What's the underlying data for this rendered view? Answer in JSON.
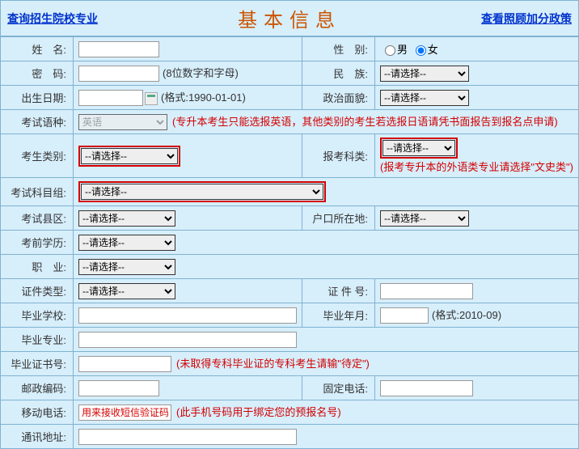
{
  "header": {
    "link_left": "查询招生院校专业",
    "title": "基本信息",
    "link_right": "查看照顾加分政策"
  },
  "labels": {
    "name": "姓　名:",
    "gender": "性　别:",
    "password": "密　码:",
    "ethnic": "民　族:",
    "birthday": "出生日期:",
    "political": "政治面貌:",
    "exam_lang": "考试语种:",
    "cand_type": "考生类别:",
    "exam_cat": "报考科类:",
    "subject_grp": "考试科目组:",
    "exam_area": "考试县区:",
    "hukou": "户口所在地:",
    "pre_edu": "考前学历:",
    "job": "职　业:",
    "id_type": "证件类型:",
    "id_no": "证 件 号:",
    "grad_school": "毕业学校:",
    "grad_ym": "毕业年月:",
    "grad_major": "毕业专业:",
    "cert_no": "毕业证书号:",
    "postal": "邮政编码:",
    "landline": "固定电话:",
    "mobile": "移动电话:",
    "address": "通讯地址:"
  },
  "options": {
    "gender_m": "男",
    "gender_f": "女",
    "please_select": "--请选择--",
    "lang_default": "英语"
  },
  "hints": {
    "password": "(8位数字和字母)",
    "birthday": "(格式:1990-01-01)",
    "lang": "(专升本考生只能选报英语，其他类别的考生若选报日语请凭书面报告到报名点申请)",
    "exam_cat": "(报考专升本的外语类专业请选择\"文史类\")",
    "cert_no": "(未取得专科毕业证的专科考生请输\"待定\")",
    "mobile_ph": "用来接收短信验证码",
    "mobile": "(此手机号码用于绑定您的预报名号)",
    "grad_ym": "(格式:2010-09)"
  }
}
